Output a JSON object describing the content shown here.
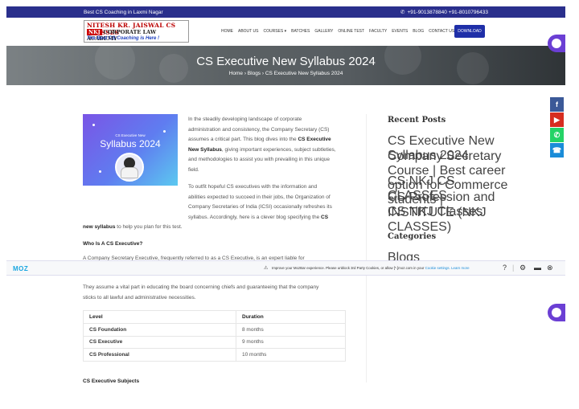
{
  "topbar": {
    "tagline": "Best CS Coaching in Laxmi Nagar",
    "phone": "+91-9013878840 +91-8010796433"
  },
  "logo": {
    "line1": "NITESH KR. JAISWAL CS CLASSES",
    "line2_badge": "NKJ",
    "line2": "CORPORATE LAW ACADEMY",
    "line3": "The Best CS-Coaching is Here !"
  },
  "nav": {
    "items": [
      "HOME",
      "ABOUT US",
      "COURSES ▾",
      "BATCHES",
      "GALLERY",
      "ONLINE TEST",
      "FACULTY",
      "EVENTS",
      "BLOG",
      "CONTACT US"
    ],
    "download_label": "DOWNLOAD"
  },
  "hero": {
    "title": "CS Executive New Syllabus 2024",
    "breadcrumb": "Home  ›  Blogs  ›  CS Executive New Syllabus 2024"
  },
  "feature_image": {
    "small_text": "CS Executive New",
    "big_text": "Syllabus 2024"
  },
  "article": {
    "intro_lines": [
      "In the steadily developing landscape of corporate",
      "administration and consistency, the Company Secretary (CS)",
      "assumes a critical part. This blog dives into the",
      "New Syllabus, giving important experiences, subject subtleties,",
      "and methodologies to assist you with prevailing in this unique",
      "field."
    ],
    "intro_bold_a": "CS Executive",
    "intro_bold_b": "New Syllabus",
    "para2_lines": [
      "To outfit hopeful CS executives with the information and",
      "abilities expected to succeed in their jobs, the Organization of",
      "Company Secretaries of India (ICSI) occasionally refreshes its",
      "syllabus. Accordingly, here is a clever blog specifying the"
    ],
    "para2_bold": "CS",
    "para2_last_bold": "new syllabus",
    "para2_last": " to help you plan for this test.",
    "heading_who": "Who Is A CS Executive?",
    "para3_partial": "A Company Secretary Executive, frequently referred to as a CS Executive, is an expert liable for",
    "para4_lines": [
      "They assume a vital part in educating the board concerning chiefs and guaranteeing that the company",
      "sticks to all lawful and administrative necessities."
    ],
    "table": {
      "headers": [
        "Level",
        "Duration"
      ],
      "rows": [
        [
          "CS Foundation",
          "8 months"
        ],
        [
          "CS Executive",
          "9 months"
        ],
        [
          "CS Professional",
          "10 months"
        ]
      ]
    },
    "heading_subjects": "CS Executive Subjects"
  },
  "sidebar": {
    "recent_title": "Recent Posts",
    "recent_posts": [
      "CS Executive New Syllabus 2024",
      "Company Secretary Course | Best career option for Commerce students |",
      "CS NKJ CS CLASSES",
      "CS Profession and CS NKJ Classes",
      "INSTITUTE (NKJ CLASSES)"
    ],
    "categories_title": "Categories",
    "categories": [
      "Blogs"
    ]
  },
  "mozbar": {
    "brand": "MOZ",
    "message": "Improve your MozBar experience. Please unblock 3rd Party Cookies, or allow [*.]moz.com in your",
    "link1": "Cookie settings.",
    "link2": "Learn more"
  },
  "colors": {
    "topbar": "#2a2f8c",
    "download": "#1f2fa8",
    "facebook": "#3b5998",
    "youtube": "#d62d20",
    "whatsapp": "#25d366",
    "call": "#1a8cd8",
    "chat_bubble": "#6b3fd4"
  }
}
